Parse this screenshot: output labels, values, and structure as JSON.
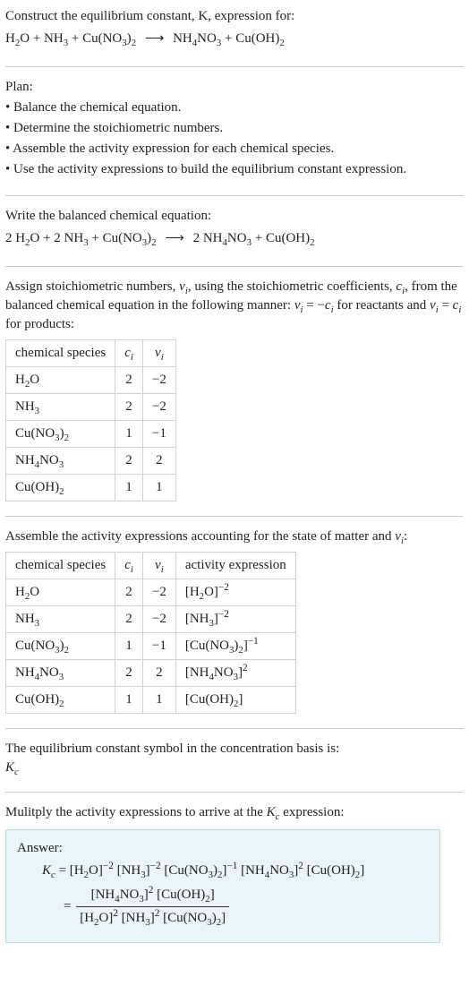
{
  "s1": {
    "title": "Construct the equilibrium constant, K, expression for:",
    "eq_lhs1": "H",
    "eq_lhs1s": "2",
    "eq_lhs2": "O + NH",
    "eq_lhs2s": "3",
    "eq_lhs3": " + Cu(NO",
    "eq_lhs3s": "3",
    "eq_lhs4": ")",
    "eq_lhs4s": "2",
    "arrow": "⟶",
    "eq_rhs1": "NH",
    "eq_rhs1s": "4",
    "eq_rhs2": "NO",
    "eq_rhs2s": "3",
    "eq_rhs3": " + Cu(OH)",
    "eq_rhs3s": "2"
  },
  "s2": {
    "title": "Plan:",
    "b1": "• Balance the chemical equation.",
    "b2": "• Determine the stoichiometric numbers.",
    "b3": "• Assemble the activity expression for each chemical species.",
    "b4": "• Use the activity expressions to build the equilibrium constant expression."
  },
  "s3": {
    "title": "Write the balanced chemical equation:",
    "c1": "2 H",
    "c1s": "2",
    "c2": "O + 2 NH",
    "c2s": "3",
    "c3": " + Cu(NO",
    "c3s": "3",
    "c4": ")",
    "c4s": "2",
    "arrow": "⟶",
    "c5": "2 NH",
    "c5s": "4",
    "c6": "NO",
    "c6s": "3",
    "c7": " + Cu(OH)",
    "c7s": "2"
  },
  "s4": {
    "intro_a": "Assign stoichiometric numbers, ",
    "nu": "ν",
    "i": "i",
    "intro_b": ", using the stoichiometric coefficients, ",
    "c": "c",
    "intro_c": ", from the balanced chemical equation in the following manner: ",
    "eq1a": "ν",
    "eq1b": " = −",
    "eq1c": "c",
    "intro_d": " for reactants and ",
    "eq2a": "ν",
    "eq2b": " = ",
    "eq2c": "c",
    "intro_e": " for products:",
    "th1": "chemical species",
    "th2": "c",
    "th3": "ν",
    "r1_s": "H2O",
    "r1_c": "2",
    "r1_v": "−2",
    "r2_s": "NH3",
    "r2_c": "2",
    "r2_v": "−2",
    "r3_s": "Cu(NO3)2",
    "r3_c": "1",
    "r3_v": "−1",
    "r4_s": "NH4NO3",
    "r4_c": "2",
    "r4_v": "2",
    "r5_s": "Cu(OH)2",
    "r5_c": "1",
    "r5_v": "1"
  },
  "s5": {
    "intro_a": "Assemble the activity expressions accounting for the state of matter and ",
    "nu": "ν",
    "i": "i",
    "intro_b": ":",
    "th1": "chemical species",
    "th2": "c",
    "th3": "ν",
    "th4": "activity expression",
    "r1_c": "2",
    "r1_v": "−2",
    "r1_e": "−2",
    "r2_c": "2",
    "r2_v": "−2",
    "r2_e": "−2",
    "r3_c": "1",
    "r3_v": "−1",
    "r3_e": "−1",
    "r4_c": "2",
    "r4_v": "2",
    "r4_e": "2",
    "r5_c": "1",
    "r5_v": "1"
  },
  "s6": {
    "line1": "The equilibrium constant symbol in the concentration basis is:",
    "K": "K",
    "c": "c"
  },
  "s7": {
    "title": "Mulitply the activity expressions to arrive at the ",
    "K": "K",
    "c": "c",
    "title2": " expression:",
    "ans": "Answer:",
    "Kc": "K",
    "Kcs": "c",
    "eq": " = ",
    "p_m2": "−2",
    "p_m1": "−1",
    "p_2": "2",
    "p_2b": "2"
  },
  "chart_data": {
    "type": "table",
    "title": "Stoichiometric numbers and activity expressions for H2O + NH3 + Cu(NO3)2 → NH4NO3 + Cu(OH)2",
    "tables": [
      {
        "columns": [
          "chemical species",
          "c_i",
          "ν_i"
        ],
        "rows": [
          [
            "H2O",
            2,
            -2
          ],
          [
            "NH3",
            2,
            -2
          ],
          [
            "Cu(NO3)2",
            1,
            -1
          ],
          [
            "NH4NO3",
            2,
            2
          ],
          [
            "Cu(OH)2",
            1,
            1
          ]
        ]
      },
      {
        "columns": [
          "chemical species",
          "c_i",
          "ν_i",
          "activity expression"
        ],
        "rows": [
          [
            "H2O",
            2,
            -2,
            "[H2O]^-2"
          ],
          [
            "NH3",
            2,
            -2,
            "[NH3]^-2"
          ],
          [
            "Cu(NO3)2",
            1,
            -1,
            "[Cu(NO3)2]^-1"
          ],
          [
            "NH4NO3",
            2,
            2,
            "[NH4NO3]^2"
          ],
          [
            "Cu(OH)2",
            1,
            1,
            "[Cu(OH)2]"
          ]
        ]
      }
    ],
    "balanced_equation": "2 H2O + 2 NH3 + Cu(NO3)2 → 2 NH4NO3 + Cu(OH)2",
    "equilibrium_constant": "K_c = ([NH4NO3]^2 [Cu(OH)2]) / ([H2O]^2 [NH3]^2 [Cu(NO3)2])"
  }
}
